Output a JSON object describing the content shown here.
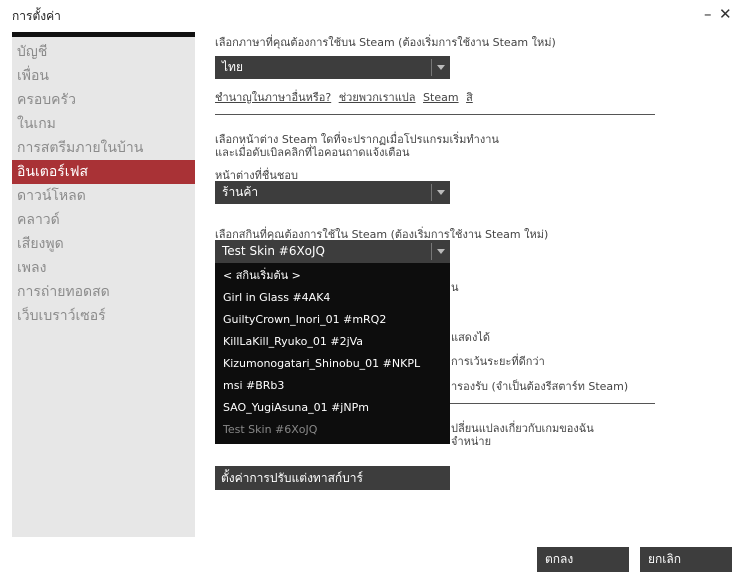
{
  "window": {
    "title": "การตั้งค่า",
    "minimize": "–",
    "close": "✕"
  },
  "sidebar": {
    "items": [
      {
        "label": "บัญชี"
      },
      {
        "label": "เพื่อน"
      },
      {
        "label": "ครอบครัว"
      },
      {
        "label": "ในเกม"
      },
      {
        "label": "การสตรีมภายในบ้าน"
      },
      {
        "label": "อินเตอร์เฟส",
        "active": true
      },
      {
        "label": "ดาวน์โหลด"
      },
      {
        "label": "คลาวด์"
      },
      {
        "label": "เสียงพูด"
      },
      {
        "label": "เพลง"
      },
      {
        "label": "การถ่ายทอดสด"
      },
      {
        "label": "เว็บเบราว์เซอร์"
      }
    ]
  },
  "language": {
    "label": "เลือกภาษาที่คุณต้องการใช้บน Steam (ต้องเริ่มการใช้งาน Steam ใหม่)",
    "value": "ไทย",
    "links": [
      "ชำนาญในภาษาอื่นหรือ?",
      "ช่วยพวกเราแปล",
      "Steam",
      "สิ"
    ]
  },
  "start_window": {
    "desc_line1": "เลือกหน้าต่าง Steam ใดที่จะปรากฏเมื่อโปรแกรมเริ่มทำงาน",
    "desc_line2": "และเมื่อดับเบิลคลิกที่ไอคอนถาดแจ้งเตือน",
    "label": "หน้าต่างที่ชื่นชอบ",
    "value": "ร้านค้า"
  },
  "skin": {
    "label": "เลือกสกินที่คุณต้องการใช้ใน Steam (ต้องเริ่มการใช้งาน Steam ใหม่)",
    "value": "Test Skin #6XoJQ",
    "options": [
      "< สกินเริ่มต้น >",
      "Girl in Glass #4AK4",
      "GuiltyCrown_Inori_01 #mRQ2",
      "KillLaKill_Ryuko_01 #2jVa",
      "Kizumonogatari_Shinobu_01 #NKPL",
      "msi #BRb3",
      "SAO_YugiAsuna_01 #jNPm",
      "Test Skin #6XoJQ"
    ]
  },
  "hidden_fragments": {
    "f1": "น",
    "f2": "แสดงได้",
    "f3": "การเว้นระยะที่ดีกว่า",
    "f4": "ารองรับ (จำเป็นต้องรีสตาร์ท Steam)",
    "f5": "ปลี่ยนแปลงเกี่ยวกับเกมของฉัน",
    "f6": "จำหน่าย"
  },
  "taskbar_button": "ตั้งค่าการปรับแต่งทาสก์บาร์",
  "buttons": {
    "ok": "ตกลง",
    "cancel": "ยกเลิก"
  }
}
